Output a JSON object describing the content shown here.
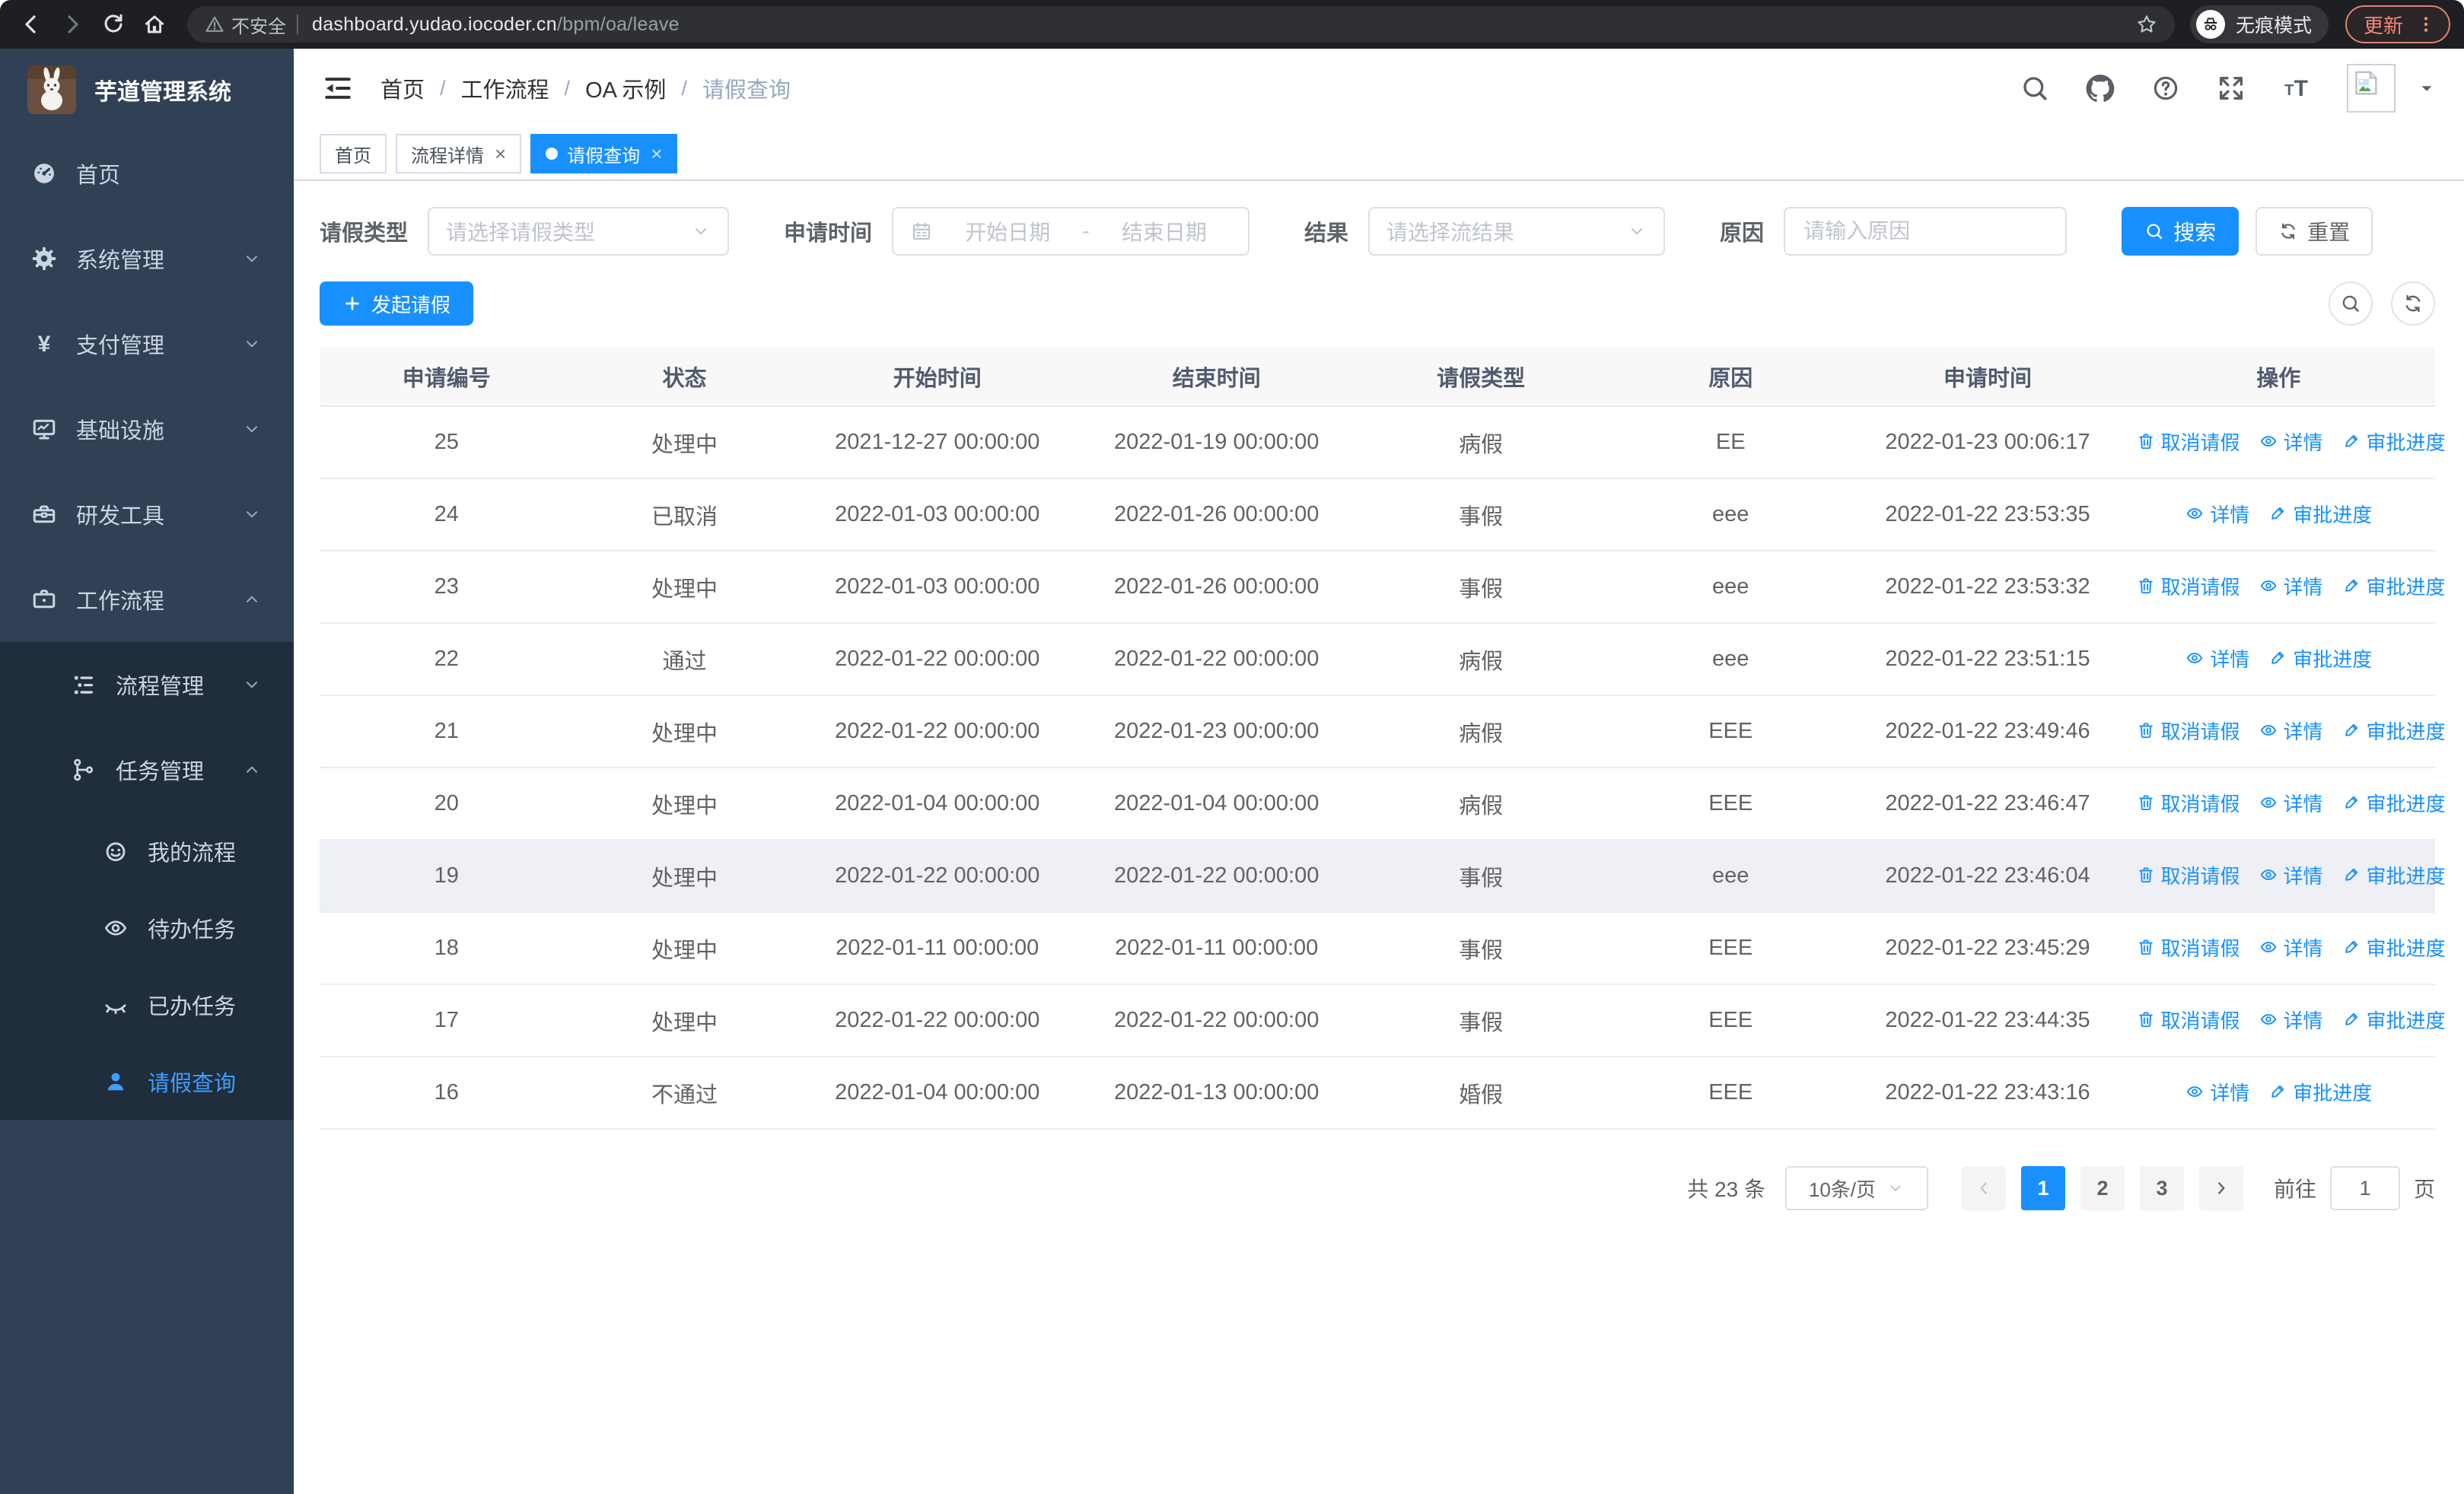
{
  "browser": {
    "security_label": "不安全",
    "url_host": "dashboard.yudao.iocoder.cn",
    "url_path": "/bpm/oa/leave",
    "incognito_label": "无痕模式",
    "update_label": "更新"
  },
  "sidebar": {
    "title": "芋道管理系统",
    "items": [
      {
        "label": "首页",
        "icon": "dashboard-icon",
        "depth": 0
      },
      {
        "label": "系统管理",
        "icon": "gear-icon",
        "depth": 0,
        "chevron": "down"
      },
      {
        "label": "支付管理",
        "icon": "yen-icon",
        "depth": 0,
        "chevron": "down"
      },
      {
        "label": "基础设施",
        "icon": "monitor-icon",
        "depth": 0,
        "chevron": "down"
      },
      {
        "label": "研发工具",
        "icon": "toolbox-icon",
        "depth": 0,
        "chevron": "down"
      },
      {
        "label": "工作流程",
        "icon": "briefcase-icon",
        "depth": 0,
        "chevron": "up"
      },
      {
        "label": "流程管理",
        "icon": "list-icon",
        "depth": 1,
        "chevron": "down",
        "submenu": true
      },
      {
        "label": "任务管理",
        "icon": "tree-icon",
        "depth": 1,
        "chevron": "up",
        "submenu": true
      },
      {
        "label": "我的流程",
        "icon": "robot-icon",
        "depth": 2,
        "submenu": true
      },
      {
        "label": "待办任务",
        "icon": "eye-icon",
        "depth": 2,
        "submenu": true
      },
      {
        "label": "已办任务",
        "icon": "eye-closed-icon",
        "depth": 2,
        "submenu": true
      },
      {
        "label": "请假查询",
        "icon": "user-icon",
        "depth": 2,
        "submenu": true,
        "active": true
      }
    ]
  },
  "header": {
    "breadcrumb": [
      "首页",
      "工作流程",
      "OA 示例",
      "请假查询"
    ]
  },
  "tags": [
    {
      "label": "首页",
      "closable": false,
      "active": false
    },
    {
      "label": "流程详情",
      "closable": true,
      "active": false
    },
    {
      "label": "请假查询",
      "closable": true,
      "active": true
    }
  ],
  "filters": {
    "leave_type_label": "请假类型",
    "leave_type_placeholder": "请选择请假类型",
    "apply_time_label": "申请时间",
    "start_date_placeholder": "开始日期",
    "date_separator": "-",
    "end_date_placeholder": "结束日期",
    "result_label": "结果",
    "result_placeholder": "请选择流结果",
    "reason_label": "原因",
    "reason_placeholder": "请输入原因",
    "search_label": "搜索",
    "reset_label": "重置"
  },
  "toolbar": {
    "create_label": "发起请假"
  },
  "table": {
    "columns": [
      "申请编号",
      "状态",
      "开始时间",
      "结束时间",
      "请假类型",
      "原因",
      "申请时间",
      "操作"
    ],
    "action_labels": {
      "cancel": "取消请假",
      "detail": "详情",
      "progress": "审批进度"
    },
    "rows": [
      {
        "id": "25",
        "status": "处理中",
        "start": "2021-12-27 00:00:00",
        "end": "2022-01-19 00:00:00",
        "type": "病假",
        "reason": "EE",
        "applied": "2022-01-23 00:06:17",
        "actions": [
          "cancel",
          "detail",
          "progress"
        ]
      },
      {
        "id": "24",
        "status": "已取消",
        "start": "2022-01-03 00:00:00",
        "end": "2022-01-26 00:00:00",
        "type": "事假",
        "reason": "eee",
        "applied": "2022-01-22 23:53:35",
        "actions": [
          "detail",
          "progress"
        ]
      },
      {
        "id": "23",
        "status": "处理中",
        "start": "2022-01-03 00:00:00",
        "end": "2022-01-26 00:00:00",
        "type": "事假",
        "reason": "eee",
        "applied": "2022-01-22 23:53:32",
        "actions": [
          "cancel",
          "detail",
          "progress"
        ]
      },
      {
        "id": "22",
        "status": "通过",
        "start": "2022-01-22 00:00:00",
        "end": "2022-01-22 00:00:00",
        "type": "病假",
        "reason": "eee",
        "applied": "2022-01-22 23:51:15",
        "actions": [
          "detail",
          "progress"
        ]
      },
      {
        "id": "21",
        "status": "处理中",
        "start": "2022-01-22 00:00:00",
        "end": "2022-01-23 00:00:00",
        "type": "病假",
        "reason": "EEE",
        "applied": "2022-01-22 23:49:46",
        "actions": [
          "cancel",
          "detail",
          "progress"
        ]
      },
      {
        "id": "20",
        "status": "处理中",
        "start": "2022-01-04 00:00:00",
        "end": "2022-01-04 00:00:00",
        "type": "病假",
        "reason": "EEE",
        "applied": "2022-01-22 23:46:47",
        "actions": [
          "cancel",
          "detail",
          "progress"
        ]
      },
      {
        "id": "19",
        "status": "处理中",
        "start": "2022-01-22 00:00:00",
        "end": "2022-01-22 00:00:00",
        "type": "事假",
        "reason": "eee",
        "applied": "2022-01-22 23:46:04",
        "actions": [
          "cancel",
          "detail",
          "progress"
        ],
        "hover": true
      },
      {
        "id": "18",
        "status": "处理中",
        "start": "2022-01-11 00:00:00",
        "end": "2022-01-11 00:00:00",
        "type": "事假",
        "reason": "EEE",
        "applied": "2022-01-22 23:45:29",
        "actions": [
          "cancel",
          "detail",
          "progress"
        ]
      },
      {
        "id": "17",
        "status": "处理中",
        "start": "2022-01-22 00:00:00",
        "end": "2022-01-22 00:00:00",
        "type": "事假",
        "reason": "EEE",
        "applied": "2022-01-22 23:44:35",
        "actions": [
          "cancel",
          "detail",
          "progress"
        ]
      },
      {
        "id": "16",
        "status": "不通过",
        "start": "2022-01-04 00:00:00",
        "end": "2022-01-13 00:00:00",
        "type": "婚假",
        "reason": "EEE",
        "applied": "2022-01-22 23:43:16",
        "actions": [
          "detail",
          "progress"
        ]
      }
    ]
  },
  "pagination": {
    "total_label": "共 23 条",
    "page_size_label": "10条/页",
    "pages": [
      "1",
      "2",
      "3"
    ],
    "active_page": "1",
    "goto_label": "前往",
    "goto_value": "1",
    "page_suffix_label": "页"
  },
  "colors": {
    "accent": "#1890ff",
    "sidebar_bg": "#304156",
    "sidebar_submenu_bg": "#1f2d3d",
    "sidebar_active": "#409eff",
    "chrome_bg": "#1e1f23",
    "update_accent": "#f08b76"
  }
}
